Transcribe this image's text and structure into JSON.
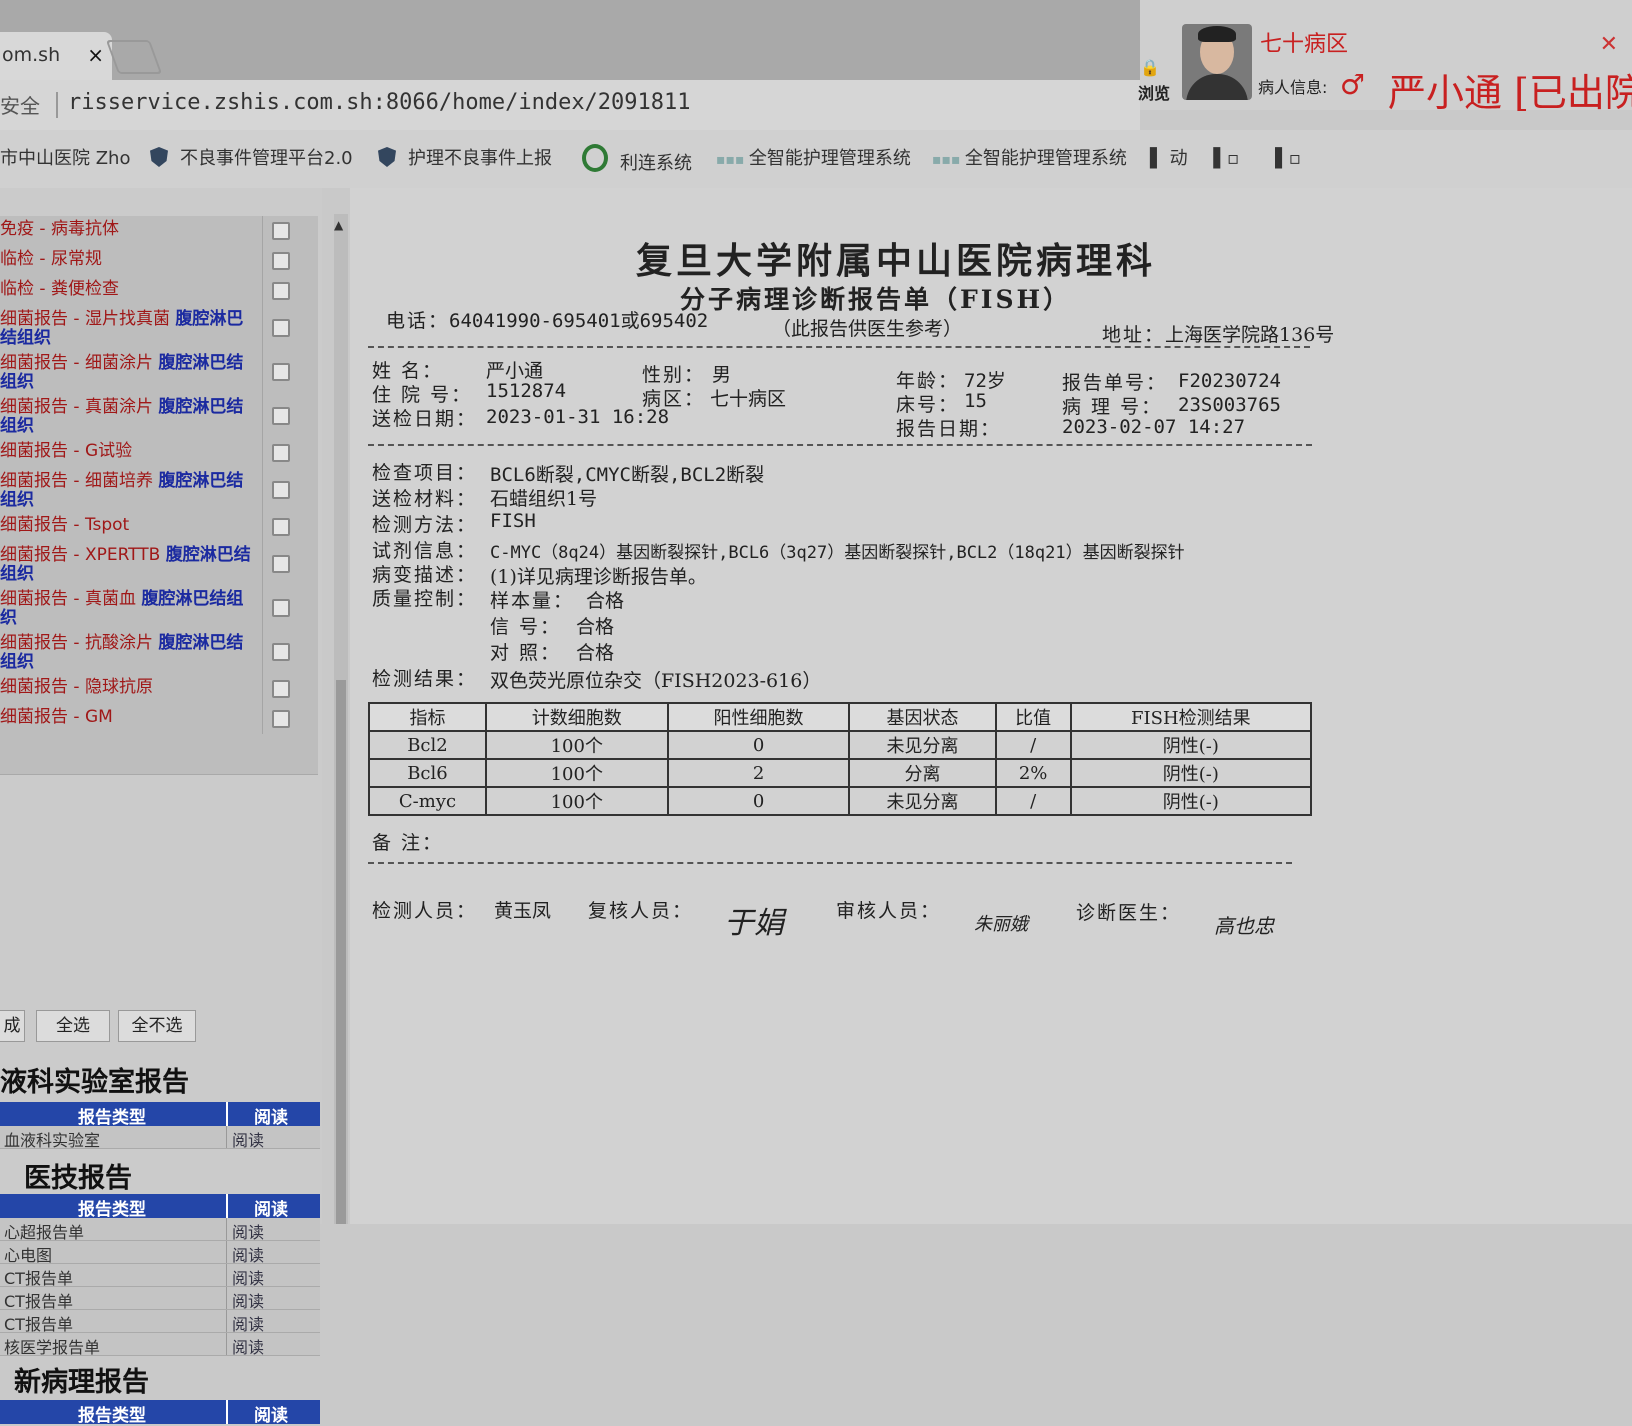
{
  "browser": {
    "tab_title": "om.sh",
    "tab_close": "×",
    "security_label": "安全",
    "url": "risservice.zshis.com.sh:8066/home/index/2091811"
  },
  "bookmarks": [
    {
      "label": "市中山医院 Zho",
      "icon": "page-icon"
    },
    {
      "label": "不良事件管理平台2.0",
      "icon": "shield-icon"
    },
    {
      "label": "护理不良事件上报",
      "icon": "shield-icon"
    },
    {
      "label": "利连系统",
      "icon": "ring-icon"
    },
    {
      "label": "全智能护理管理系统",
      "icon": "dots-icon"
    },
    {
      "label": "全智能护理管理系统",
      "icon": "dots-icon"
    },
    {
      "label": "动",
      "icon": "folder-icon"
    }
  ],
  "patient_header": {
    "browse_label": "浏览",
    "ward": "七十病区",
    "info_label": "病人信息:",
    "gender_symbol": "♂",
    "name_status": "严小通 [已出院"
  },
  "sidebar": {
    "lab_items": [
      {
        "text": "免疫 - 病毒抗体",
        "sample": ""
      },
      {
        "text": "临检 - 尿常规",
        "sample": ""
      },
      {
        "text": "临检 - 粪便检查",
        "sample": ""
      },
      {
        "text": "细菌报告 - 湿片找真菌 ",
        "sample": "腹腔淋巴结组织"
      },
      {
        "text": "细菌报告 - 细菌涂片 ",
        "sample": "腹腔淋巴结组织"
      },
      {
        "text": "细菌报告 - 真菌涂片 ",
        "sample": "腹腔淋巴结组织"
      },
      {
        "text": "细菌报告 - G试验",
        "sample": ""
      },
      {
        "text": "细菌报告 - 细菌培养 ",
        "sample": "腹腔淋巴结组织"
      },
      {
        "text": "细菌报告 - Tspot",
        "sample": ""
      },
      {
        "text": "细菌报告 - XPERTTB ",
        "sample": "腹腔淋巴结组织"
      },
      {
        "text": "细菌报告 - 真菌血 ",
        "sample": "腹腔淋巴结组织"
      },
      {
        "text": "细菌报告 - 抗酸涂片 ",
        "sample": "腹腔淋巴结组织"
      },
      {
        "text": "细菌报告 - 隐球抗原",
        "sample": ""
      },
      {
        "text": "细菌报告 - GM",
        "sample": ""
      }
    ],
    "btn_partial": "成",
    "btn_select_all": "全选",
    "btn_select_none": "全不选",
    "blood_lab_title": "液科实验室报告",
    "blood_table_header": [
      "报告类型",
      "阅读"
    ],
    "blood_rows": [
      [
        "血液科实验室",
        "阅读"
      ]
    ],
    "tech_title": "医技报告",
    "tech_table_header": [
      "报告类型",
      "阅读"
    ],
    "tech_rows": [
      [
        "心超报告单",
        "阅读"
      ],
      [
        "心电图",
        "阅读"
      ],
      [
        "CT报告单",
        "阅读"
      ],
      [
        "CT报告单",
        "阅读"
      ],
      [
        "CT报告单",
        "阅读"
      ],
      [
        "核医学报告单",
        "阅读"
      ]
    ],
    "new_path_title": "新病理报告",
    "new_path_header": [
      "报告类型",
      "阅读"
    ]
  },
  "report": {
    "hospital_title": "复旦大学附属中山医院病理科",
    "report_title": "分子病理诊断报告单（FISH）",
    "phone_label": "电话：",
    "phone_value": "64041990-695401或695402",
    "reference_note": "（此报告供医生参考）",
    "address_label": "地址：",
    "address_value": "上海医学院路136号",
    "name_label": "姓  名：",
    "name_value": "严小通",
    "sex_label": "性别：",
    "sex_value": "男",
    "age_label": "年龄：",
    "age_value": "72岁",
    "report_no_label": "报告单号：",
    "report_no_value": "F20230724",
    "inpatient_label": "住 院 号：",
    "inpatient_value": "1512874",
    "ward_label": "病区：",
    "ward_value": "七十病区",
    "bed_label": "床号：",
    "bed_value": "15",
    "path_no_label": "病 理 号：",
    "path_no_value": "23S003765",
    "sent_label": "送检日期：",
    "sent_value": "2023-01-31 16:28",
    "report_date_label": "报告日期：",
    "report_date_value": "2023-02-07 14:27",
    "item_label": "检查项目：",
    "item_value": "BCL6断裂,CMYC断裂,BCL2断裂",
    "material_label": "送检材料：",
    "material_value": "石蜡组织1号",
    "method_label": "检测方法：",
    "method_value": "FISH",
    "reagent_label": "试剂信息：",
    "reagent_value": "C-MYC（8q24）基因断裂探针,BCL6（3q27）基因断裂探针,BCL2（18q21）基因断裂探针",
    "lesion_label": "病变描述：",
    "lesion_value": "(1)详见病理诊断报告单。",
    "qc_label": "质量控制：",
    "qc_sample_label": "样本量：",
    "qc_sample_value": "合格",
    "qc_signal_label": "信  号：",
    "qc_signal_value": "合格",
    "qc_control_label": "对  照：",
    "qc_control_value": "合格",
    "result_label": "检测结果：",
    "result_value": "双色荧光原位杂交（FISH2023-616）",
    "table_headers": [
      "指标",
      "计数细胞数",
      "阳性细胞数",
      "基因状态",
      "比值",
      "FISH检测结果"
    ],
    "table_rows": [
      [
        "Bcl2",
        "100个",
        "0",
        "未见分离",
        "/",
        "阴性(-)"
      ],
      [
        "Bcl6",
        "100个",
        "2",
        "分离",
        "2%",
        "阴性(-)"
      ],
      [
        "C-myc",
        "100个",
        "0",
        "未见分离",
        "/",
        "阴性(-)"
      ]
    ],
    "remark_label": "备  注：",
    "tester_label": "检测人员：",
    "tester_value": "黄玉凤",
    "reviewer_label": "复核人员：",
    "reviewer_sig": "于娟",
    "auditor_label": "审核人员：",
    "auditor_sig": "朱丽娥",
    "doctor_label": "诊断医生：",
    "doctor_sig": "高也忠"
  }
}
